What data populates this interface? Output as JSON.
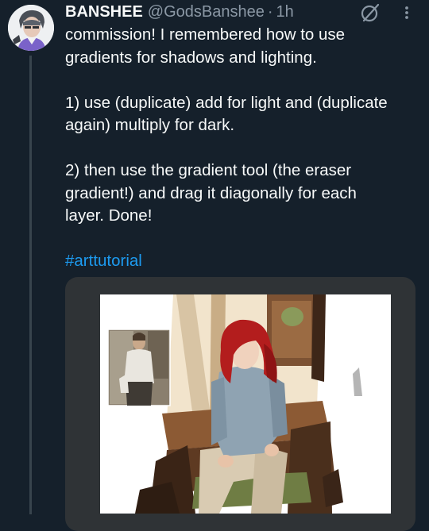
{
  "author": {
    "display_name": "BANSHEE",
    "handle": "@GodsBanshee",
    "separator": "·",
    "time": "1h"
  },
  "tweet": {
    "lines": [
      "commission! I remembered how to use",
      "gradients for shadows and lighting.",
      "1) use (duplicate) add for light and (duplicate",
      "again) multiply for dark.",
      "2) then use the gradient tool (the eraser",
      "gradient!) and drag it diagonally for each",
      "layer. Done!"
    ],
    "hashtag": "#arttutorial"
  },
  "icons": {
    "avatar": "avatar",
    "grok": "grok-icon",
    "more": "more-icon"
  },
  "colors": {
    "background": "#15202b",
    "text": "#f7f9f9",
    "muted": "#8b98a5",
    "link": "#1d9bf0",
    "media_frame": "#2f3336"
  }
}
